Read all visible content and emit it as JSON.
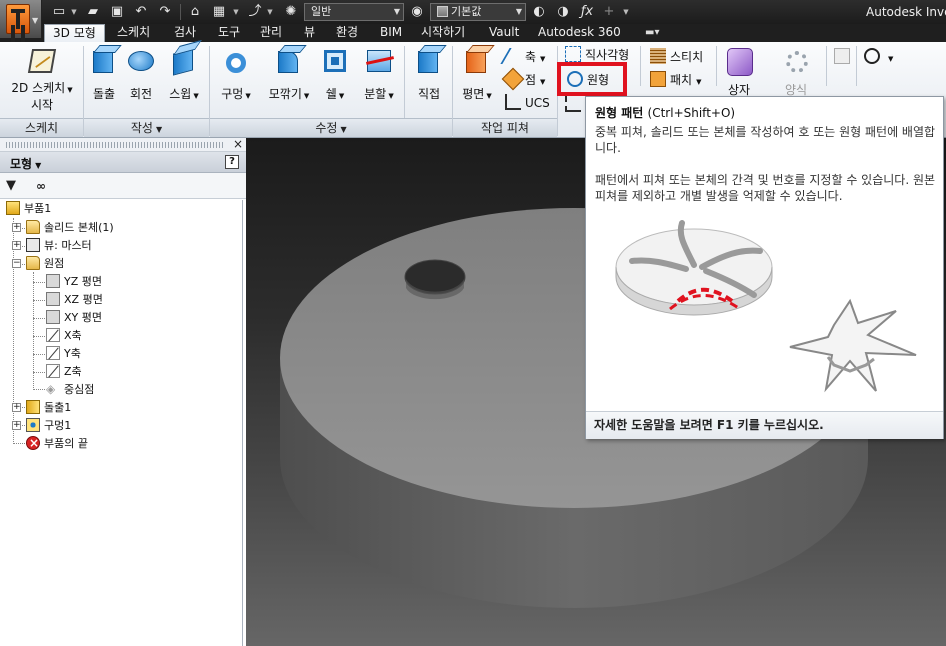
{
  "app": {
    "title": "Autodesk Inve",
    "style_combo": "일반",
    "material_combo": "기본값"
  },
  "tabs": [
    {
      "label": "3D 모형",
      "active": true
    },
    {
      "label": "스케치"
    },
    {
      "label": "검사"
    },
    {
      "label": "도구"
    },
    {
      "label": "관리"
    },
    {
      "label": "뷰"
    },
    {
      "label": "환경"
    },
    {
      "label": "BIM"
    },
    {
      "label": "시작하기"
    },
    {
      "label": "Vault"
    },
    {
      "label": "Autodesk 360"
    }
  ],
  "ribbon": {
    "sketch": {
      "btn_line1": "2D 스케치",
      "btn_line2": "시작",
      "footer": "스케치"
    },
    "create": {
      "extrude": "돌출",
      "revolve": "회전",
      "sweep": "스윕",
      "footer": "작성"
    },
    "modify": {
      "hole": "구멍",
      "fillet": "모깎기",
      "shell": "쉘",
      "split": "분할",
      "direct": "직접",
      "footer": "수정"
    },
    "work": {
      "plane": "평면",
      "axis": "축",
      "point": "점",
      "ucs": "UCS",
      "footer": "작업 피쳐"
    },
    "pattern": {
      "rect": "직사각형",
      "circular": "원형"
    },
    "surface": {
      "stitch": "스티치",
      "patch": "패치"
    },
    "plastic": {
      "box": "상자",
      "form": "양식"
    }
  },
  "browser": {
    "title": "모형",
    "help": "?",
    "close": "×",
    "tree": [
      {
        "label": "부품1"
      },
      {
        "label": "솔리드 본체(1)"
      },
      {
        "label": "뷰: 마스터"
      },
      {
        "label": "원점"
      },
      {
        "label": "YZ 평면"
      },
      {
        "label": "XZ 평면"
      },
      {
        "label": "XY 평면"
      },
      {
        "label": "X축"
      },
      {
        "label": "Y축"
      },
      {
        "label": "Z축"
      },
      {
        "label": "중심점"
      },
      {
        "label": "돌출1"
      },
      {
        "label": "구멍1"
      },
      {
        "label": "부품의 끝"
      }
    ]
  },
  "tooltip": {
    "title": "원형 패턴",
    "shortcut": "(Ctrl+Shift+O)",
    "desc1": "중복 피쳐, 솔리드 또는 본체를 작성하여 호 또는 원형 패턴에 배열합니다.",
    "desc2": "패턴에서 피쳐 또는 본체의 간격 및 번호를 지정할 수 있습니다. 원본 피쳐를 제외하고 개별 발생을 억제할 수 있습니다.",
    "footer": "자세한 도움말을 보려면 F1 키를 누르십시오."
  },
  "colors": {
    "highlight": "#e0121f",
    "dark_bar": "#1f1f1f",
    "model_face": "#8a8a8a"
  }
}
